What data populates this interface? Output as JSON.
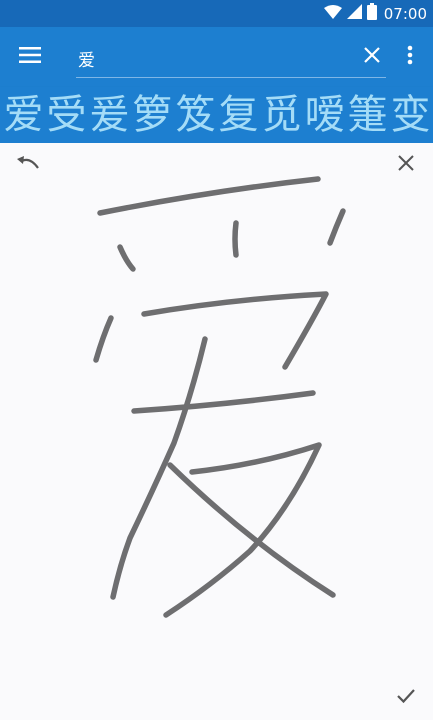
{
  "status_bar": {
    "time": "07:00",
    "icons": [
      "wifi-icon",
      "signal-icon",
      "battery-icon"
    ]
  },
  "app_bar": {
    "menu_icon": "hamburger-menu-icon",
    "search_value": "爱",
    "search_placeholder": "",
    "clear_icon": "close-icon",
    "overflow_icon": "more-vert-icon"
  },
  "candidates": [
    "爱",
    "受",
    "爰",
    "箩",
    "笈",
    "复",
    "觅",
    "嗳",
    "箑",
    "变"
  ],
  "canvas": {
    "undo_icon": "undo-icon",
    "close_icon": "close-icon",
    "done_icon": "check-icon",
    "ink_color": "#6e6e70"
  },
  "colors": {
    "status_bar": "#1769b8",
    "app_bar": "#1d7fd0",
    "candidate_text": "#a4dcf7",
    "canvas_bg": "#fafafc"
  }
}
